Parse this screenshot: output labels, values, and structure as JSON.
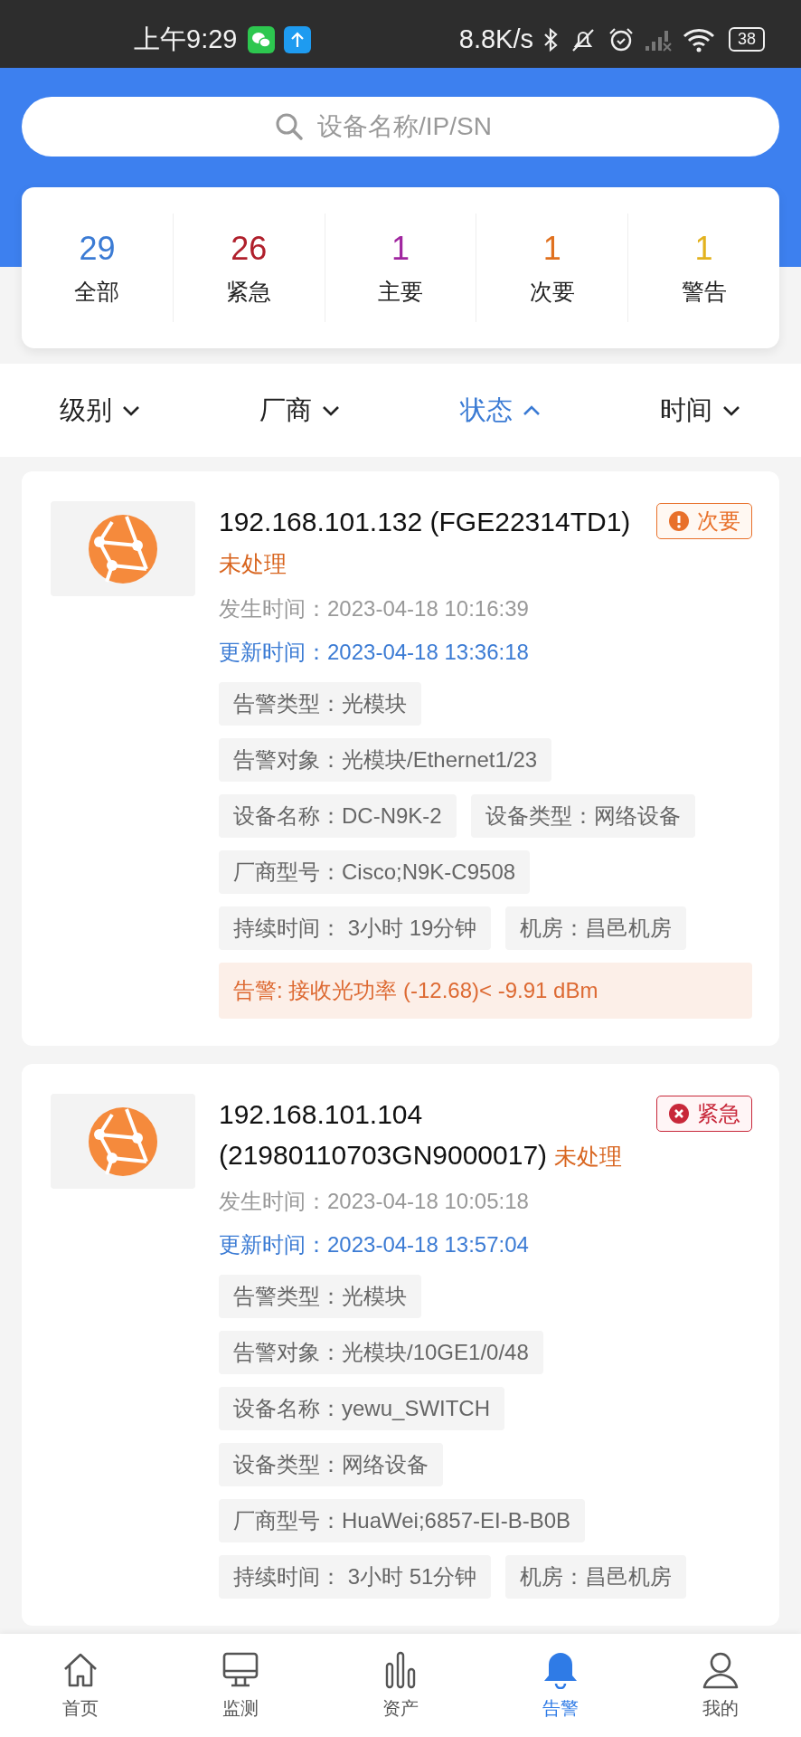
{
  "status_bar": {
    "time": "上午9:29",
    "net_speed": "8.8K/s",
    "battery": "38"
  },
  "search": {
    "placeholder": "设备名称/IP/SN"
  },
  "summary": [
    {
      "count": "29",
      "label": "全部",
      "color": "#3b7bd4"
    },
    {
      "count": "26",
      "label": "紧急",
      "color": "#b0202c"
    },
    {
      "count": "1",
      "label": "主要",
      "color": "#a0259f"
    },
    {
      "count": "1",
      "label": "次要",
      "color": "#e0701e"
    },
    {
      "count": "1",
      "label": "警告",
      "color": "#e3b21e"
    }
  ],
  "filters": [
    {
      "label": "级别",
      "selected": false,
      "expanded": false
    },
    {
      "label": "厂商",
      "selected": false,
      "expanded": false
    },
    {
      "label": "状态",
      "selected": true,
      "expanded": true
    },
    {
      "label": "时间",
      "selected": false,
      "expanded": false
    }
  ],
  "alarms": [
    {
      "ip": "192.168.101.132",
      "serial": "(FGE22314TD1)",
      "status": "未处理",
      "severity": {
        "kind": "minor",
        "label": "次要"
      },
      "occurred": "发生时间：2023-04-18 10:16:39",
      "updated": "更新时间：2023-04-18 13:36:18",
      "tag_rows": [
        [
          "告警类型：光模块"
        ],
        [
          "告警对象：光模块/Ethernet1/23"
        ],
        [
          "设备名称：DC-N9K-2",
          "设备类型：网络设备"
        ],
        [
          "厂商型号：Cisco;N9K-C9508"
        ],
        [
          "持续时间： 3小时 19分钟",
          "机房：昌邑机房"
        ]
      ],
      "message": "告警: 接收光功率 (-12.68)< -9.91 dBm"
    },
    {
      "ip": "192.168.101.104",
      "serial": "(21980110703GN9000017)",
      "status": "未处理",
      "severity": {
        "kind": "critical",
        "label": "紧急"
      },
      "occurred": "发生时间：2023-04-18 10:05:18",
      "updated": "更新时间：2023-04-18 13:57:04",
      "tag_rows": [
        [
          "告警类型：光模块"
        ],
        [
          "告警对象：光模块/10GE1/0/48"
        ],
        [
          "设备名称：yewu_SWITCH"
        ],
        [
          "设备类型：网络设备"
        ],
        [
          "厂商型号：HuaWei;6857-EI-B-B0B"
        ],
        [
          "持续时间： 3小时 51分钟",
          "机房：昌邑机房"
        ]
      ]
    }
  ],
  "tabbar": [
    {
      "kind": "home",
      "label": "首页",
      "selected": false
    },
    {
      "kind": "monitor",
      "label": "监测",
      "selected": false
    },
    {
      "kind": "assets",
      "label": "资产",
      "selected": false
    },
    {
      "kind": "alarm",
      "label": "告警",
      "selected": true
    },
    {
      "kind": "profile",
      "label": "我的",
      "selected": false
    }
  ]
}
